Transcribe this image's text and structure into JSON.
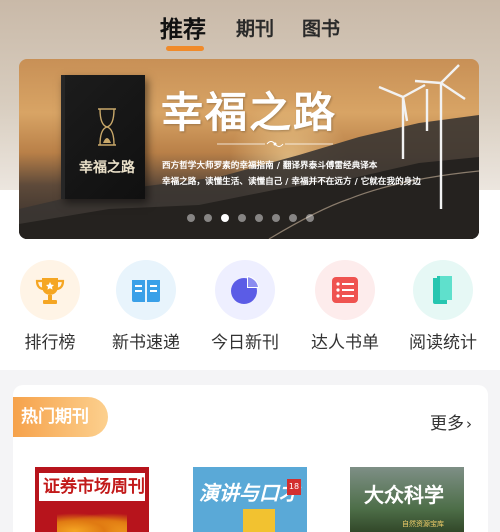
{
  "tabs": [
    {
      "label": "推荐",
      "active": true
    },
    {
      "label": "期刊",
      "active": false
    },
    {
      "label": "图书",
      "active": false
    }
  ],
  "banner": {
    "title": "幸福之路",
    "line1": "西方哲学大师罗素的幸福指南 / 翻译界泰斗傅雷经典译本",
    "line2": "幸福之路，读懂生活、读懂自己 / 幸福并不在远方 / 它就在我的身边",
    "book_title": "幸福之路",
    "dots_total": 8,
    "active_dot_index": 2
  },
  "quick_nav": [
    {
      "label": "排行榜",
      "icon": "trophy-icon",
      "color": "#f5a623"
    },
    {
      "label": "新书速递",
      "icon": "open-book-icon",
      "color": "#3aa0e8"
    },
    {
      "label": "今日新刊",
      "icon": "pie-chart-icon",
      "color": "#5b5ce6"
    },
    {
      "label": "达人书单",
      "icon": "list-icon",
      "color": "#ef5350"
    },
    {
      "label": "阅读统计",
      "icon": "books-stack-icon",
      "color": "#26c6b0"
    }
  ],
  "section": {
    "title": "热门期刊",
    "more_label": "更多",
    "more_icon": "chevron-right-icon"
  },
  "magazines": [
    {
      "title": "证券市场周刊"
    },
    {
      "title": "演讲与口才",
      "issue": "18"
    },
    {
      "title": "大众科学",
      "subtitle": "自然资源宝库"
    }
  ],
  "colors": {
    "accent": "#f08a2a",
    "section_gradient_start": "#f6a24b",
    "section_gradient_end": "#fcd08e"
  }
}
